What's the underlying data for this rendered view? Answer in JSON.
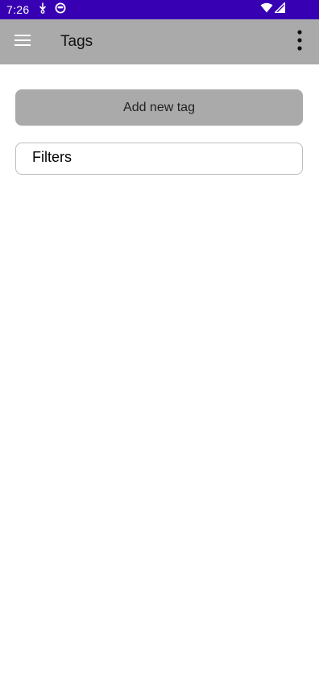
{
  "status_bar": {
    "time": "7:26",
    "left_icons": [
      "download-icon",
      "app-notification-icon"
    ],
    "right_icons": [
      "wifi-icon",
      "signal-icon"
    ],
    "background_color": "#3700B3"
  },
  "app_bar": {
    "title": "Tags",
    "menu_icon": "hamburger-menu-icon",
    "overflow_icon": "more-vert-icon",
    "background_color": "#AAAAAA"
  },
  "main": {
    "add_tag_label": "Add new tag",
    "filters_label": "Filters"
  }
}
